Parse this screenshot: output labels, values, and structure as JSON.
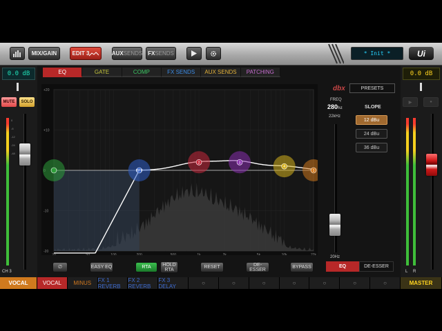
{
  "toolbar": {
    "meter_icon": "level-meter-icon",
    "mix_gain": "MIX/GAIN",
    "edit_prefix": "EDIT",
    "edit_num": "3",
    "aux_a": "AUX",
    "aux_b": "SENDS",
    "fx_a": "FX",
    "fx_b": "SENDS",
    "play_icon": "play-icon",
    "gear_icon": "gear-icon",
    "scene": "* Init *",
    "logo": "Ui"
  },
  "channel": {
    "db": "0.0 dB",
    "mute": "MUTE",
    "solo": "SOLO",
    "label": "CH 3",
    "name": "VOCAL",
    "fader_level": 0.78
  },
  "master": {
    "db": "0.0 dB",
    "meter_l": "L",
    "meter_r": "R",
    "name": "MASTER",
    "fader_level": 0.7
  },
  "tabs": [
    {
      "label": "EQ",
      "color": "#ffffff",
      "active": true
    },
    {
      "label": "GATE",
      "color": "#c8c83c",
      "active": false
    },
    {
      "label": "COMP",
      "color": "#3cc864",
      "active": false
    },
    {
      "label": "FX SENDS",
      "color": "#3c8ce6",
      "active": false
    },
    {
      "label": "AUX SENDS",
      "color": "#e6b43c",
      "active": false
    },
    {
      "label": "PATCHING",
      "color": "#c86ed2",
      "active": false
    }
  ],
  "graph": {
    "y_ticks": [
      "+20",
      "+10",
      "0",
      "-10",
      "-20"
    ],
    "x_ticks": [
      "20",
      "50",
      "100",
      "200",
      "500",
      "1k",
      "2k",
      "5k",
      "10k",
      "22k"
    ],
    "bands": [
      {
        "label": "",
        "freq": 20,
        "gain": 0,
        "color": "#2e9e3a"
      },
      {
        "label": "HPF",
        "freq": 200,
        "gain": 0,
        "color": "#2f5fc8"
      },
      {
        "label": "2",
        "freq": 1000,
        "gain": 2,
        "color": "#c8283c"
      },
      {
        "label": "3",
        "freq": 3000,
        "gain": 2,
        "color": "#8a2fb0"
      },
      {
        "label": "4",
        "freq": 10000,
        "gain": 1,
        "color": "#d6b21e"
      },
      {
        "label": "1",
        "freq": 22000,
        "gain": 0,
        "color": "#d0781e"
      }
    ]
  },
  "graph_buttons": {
    "phase": "∅",
    "easy_eq": "EASY EQ",
    "rta": "RTA",
    "hold_rta_1": "HOLD",
    "hold_rta_2": "RTA",
    "reset": "RESET",
    "de_esser": "DE-ESSER",
    "bypass": "BYPASS"
  },
  "right_panel": {
    "brand": "dbx",
    "presets": "PRESETS",
    "freq_label": "FREQ",
    "freq_value": "280",
    "freq_unit": "hz",
    "freq_max": "22kHz",
    "freq_min": "20Hz",
    "slope_label": "SLOPE",
    "slopes": [
      "12 dBu",
      "24 dBu",
      "36 dBu"
    ],
    "slope_selected": 0,
    "eq_tab": "EQ",
    "de_esser_tab": "DE-ESSER",
    "freq_fader_level": 0.55
  },
  "bottom_bar": [
    {
      "label": "VOCAL",
      "color": "#ffffff",
      "bg": "#b72828"
    },
    {
      "label": "MINUS",
      "color": "#d0781e",
      "bg": "#1e1e1e"
    },
    {
      "label": "FX 1 REVERB",
      "color": "#3d6bd0",
      "bg": "#1e1e1e"
    },
    {
      "label": "FX 2 REVERB",
      "color": "#3d6bd0",
      "bg": "#1e1e1e"
    },
    {
      "label": "FX 3 DELAY",
      "color": "#3d6bd0",
      "bg": "#1e1e1e"
    },
    {
      "label": "○",
      "color": "#888888",
      "bg": "#1e1e1e"
    },
    {
      "label": "○",
      "color": "#888888",
      "bg": "#1e1e1e"
    },
    {
      "label": "○",
      "color": "#888888",
      "bg": "#1e1e1e"
    },
    {
      "label": "○",
      "color": "#888888",
      "bg": "#1e1e1e"
    },
    {
      "label": "○",
      "color": "#888888",
      "bg": "#1e1e1e"
    },
    {
      "label": "○",
      "color": "#888888",
      "bg": "#1e1e1e"
    },
    {
      "label": "○",
      "color": "#888888",
      "bg": "#1e1e1e"
    }
  ],
  "colors": {
    "accent": "#b72828",
    "teal": "#21e2b8"
  }
}
